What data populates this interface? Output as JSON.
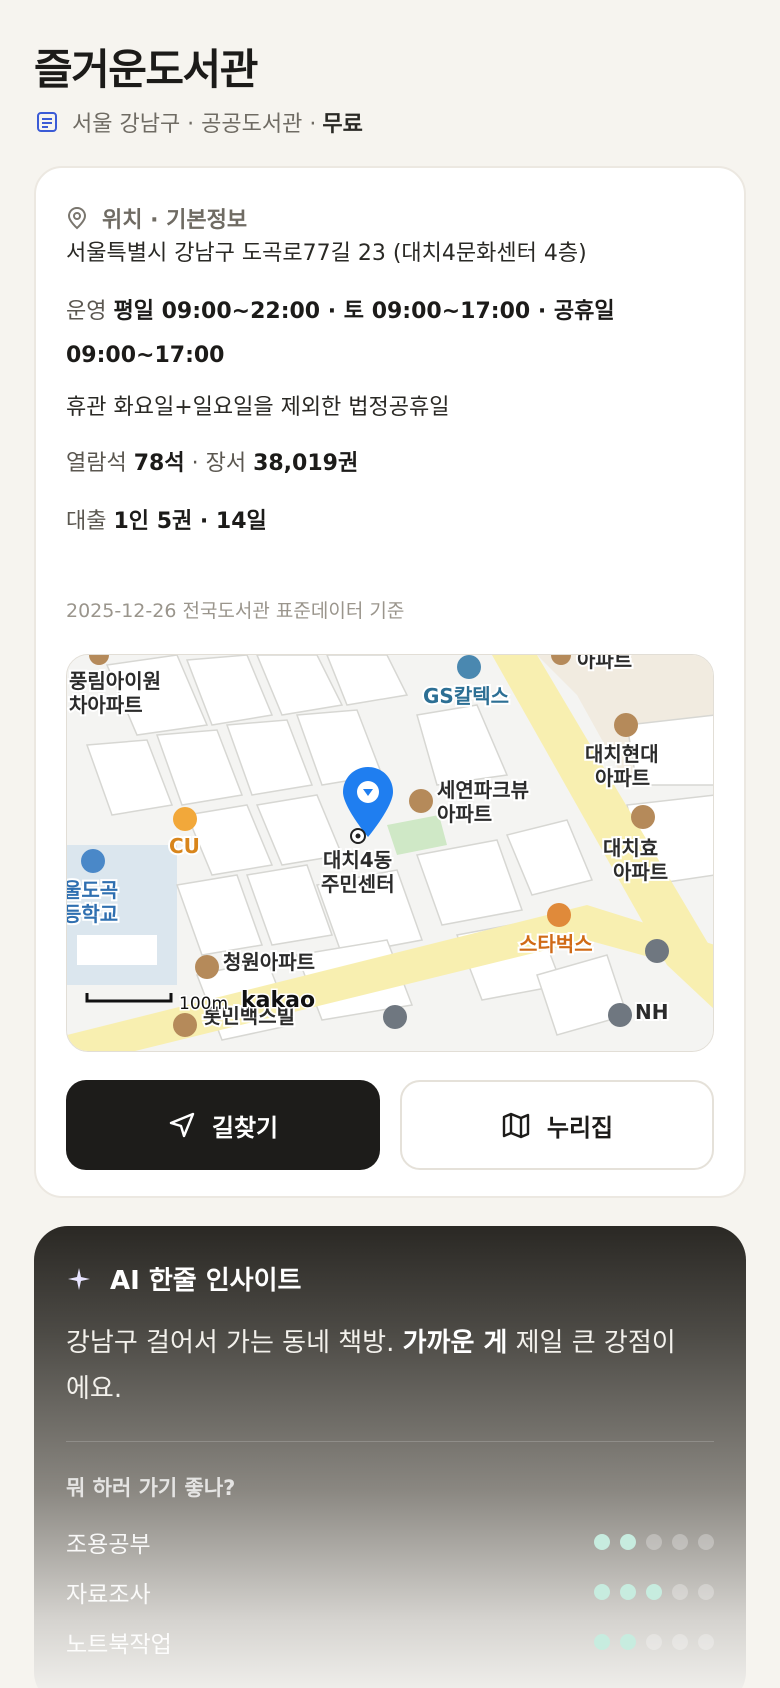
{
  "header": {
    "title": "즐거운도서관",
    "meta": "서울 강남구 · 공공도서관 ·",
    "fee": "무료"
  },
  "info": {
    "section_title": "위치 · 기본정보",
    "address": "서울특별시 강남구 도곡로77길 23 (대치4문화센터 4층)",
    "hours_label": "운영",
    "hours_value": "평일 09:00~22:00 · 토 09:00~17:00 · 공휴일 09:00~17:00",
    "closed": "휴관 화요일+일요일을 제외한 법정공휴일",
    "seats_label": "열람석",
    "seats_value": "78석",
    "books_label": "· 장서",
    "books_value": "38,019권",
    "loan_label": "대출",
    "loan_value": "1인 5권 · 14일",
    "data_ref": "2025-12-26 전국도서관 표준데이터 기준"
  },
  "map": {
    "pin_label_1": "대치4동",
    "pin_label_2": "주민센터",
    "places": {
      "gs": "GS칼텍스",
      "seyeon_1": "세연파크뷰",
      "seyeon_2": "아파트",
      "daechi_hyundai_1": "대치현대",
      "daechi_hyundai_2": "아파트",
      "daechi_hyo_1": "대치효",
      "daechi_hyo_2": "아파트",
      "pungrim_1": "풍림아이원",
      "pungrim_2": "차아파트",
      "cu": "CU",
      "school_1": "울도곡",
      "school_2": "등학교",
      "cheongwon": "청원아파트",
      "starbucks": "스타벅스",
      "top_apt": "아파트",
      "bottom": "롯민백스빌",
      "nh": "NH"
    },
    "scale": "100m",
    "logo": "kakao",
    "colors": {
      "pin": "#1f7ef0",
      "road": "#f8efb0",
      "park": "#cfe8c6"
    }
  },
  "actions": {
    "directions": "길찾기",
    "nurijip": "누리집"
  },
  "ai": {
    "title": "AI 한줄 인사이트",
    "text_1": "강남구 걸어서 가는 동네 책방. ",
    "text_bold": "가까운 게",
    "text_2": " 제일 큰 강점이에요.",
    "question": "뭐 하러 가기 좋나?",
    "activities": [
      {
        "name": "조용공부",
        "score": 2,
        "max": 5
      },
      {
        "name": "자료조사",
        "score": 3,
        "max": 5
      },
      {
        "name": "노트북작업",
        "score": 2,
        "max": 5
      }
    ]
  }
}
